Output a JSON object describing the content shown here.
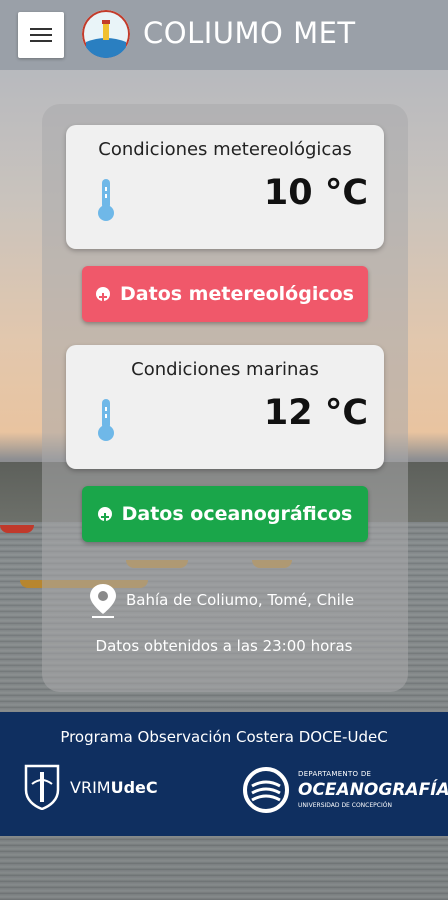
{
  "app": {
    "title": "COLIUMO MET"
  },
  "weather_card": {
    "title": "Condiciones metereológicas",
    "temperature": "10 °C"
  },
  "weather_button": {
    "label": "Datos metereológicos",
    "color": "#f0586a"
  },
  "marine_card": {
    "title": "Condiciones marinas",
    "temperature": "12 °C"
  },
  "marine_button": {
    "label": "Datos oceanográficos",
    "color": "#1aa64a"
  },
  "info": {
    "location": "Bahía de Coliumo, Tomé, Chile",
    "timestamp": "Datos obtenidos a las 23:00 horas"
  },
  "footer": {
    "program": "Programa Observación Costera DOCE-UdeC",
    "vrim_prefix": "VRIM",
    "vrim_suffix": "UdeC",
    "dept_small": "DEPARTAMENTO DE",
    "dept_name": "OCEANOGRAFÍA",
    "university": "UNIVERSIDAD DE CONCEPCIÓN"
  },
  "icons": [
    "menu-icon",
    "app-logo-icon",
    "thermometer-icon",
    "plus-circle-icon",
    "location-pin-icon",
    "udec-shield-icon",
    "oceanography-logo-icon"
  ],
  "colors": {
    "footer_bg": "#0f2f60",
    "topbar_bg": "#9aa0a8",
    "thermometer": "#6fb8e8"
  }
}
